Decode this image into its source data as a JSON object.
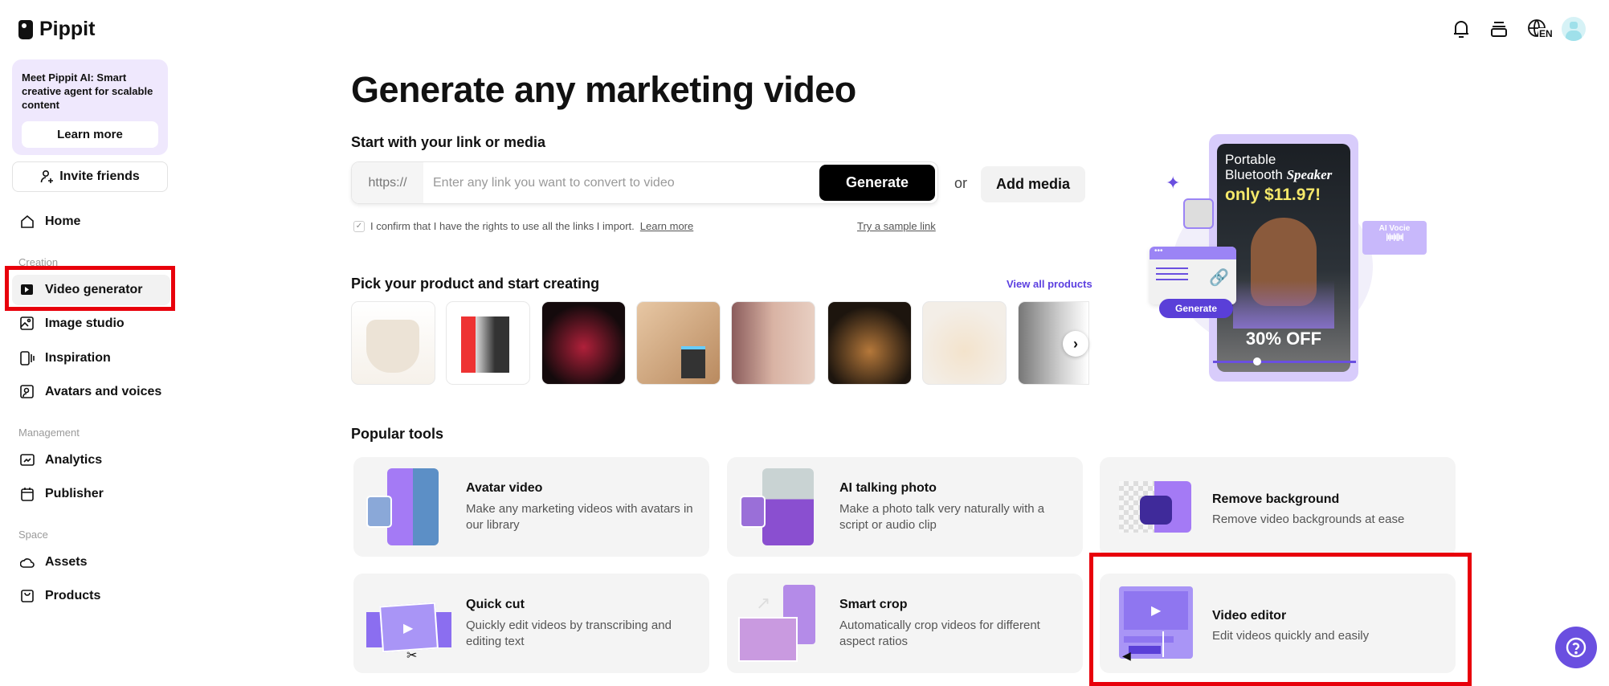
{
  "brand": {
    "name": "Pippit"
  },
  "header": {
    "language": "EN",
    "icons": [
      "bell-icon",
      "credits-icon",
      "globe-icon",
      "avatar"
    ]
  },
  "sidebar": {
    "promo": {
      "text": "Meet Pippit AI: Smart creative agent for scalable content",
      "button": "Learn more"
    },
    "invite": "Invite friends",
    "home": "Home",
    "sections": [
      {
        "label": "Creation",
        "items": [
          "Video generator",
          "Image studio",
          "Inspiration",
          "Avatars and voices"
        ]
      },
      {
        "label": "Management",
        "items": [
          "Analytics",
          "Publisher"
        ]
      },
      {
        "label": "Space",
        "items": [
          "Assets",
          "Products"
        ]
      }
    ],
    "active": "Video generator"
  },
  "main": {
    "title": "Generate any marketing video",
    "link_section": {
      "heading": "Start with your link or media",
      "prefix": "https://",
      "placeholder": "Enter any link you want to convert to video",
      "generate": "Generate",
      "or": "or",
      "add_media": "Add media",
      "confirm_text": "I confirm that I have the rights to use all the links I import.",
      "learn_more": "Learn more",
      "sample": "Try a sample link"
    },
    "products": {
      "heading": "Pick your product and start creating",
      "view_all": "View all products",
      "thumbs": [
        "handbag",
        "product-box",
        "glass-vase",
        "speaker",
        "makeup-palette",
        "candle-lamp",
        "flowers",
        "portrait"
      ]
    },
    "hero": {
      "line1": "Portable",
      "line2": "Bluetooth",
      "line2b": "Speaker",
      "price": "only $11.97!",
      "discount": "30% OFF",
      "ai_voice": "AI Vocie",
      "generate": "Generate"
    },
    "tools": {
      "heading": "Popular tools",
      "items": [
        {
          "title": "Avatar video",
          "desc": "Make any marketing videos with avatars in our library"
        },
        {
          "title": "AI talking photo",
          "desc": "Make a photo talk very naturally with a script or audio clip"
        },
        {
          "title": "Remove background",
          "desc": "Remove video backgrounds at ease"
        },
        {
          "title": "Quick cut",
          "desc": "Quickly edit videos by transcribing and editing text"
        },
        {
          "title": "Smart crop",
          "desc": "Automatically crop videos for different aspect ratios"
        },
        {
          "title": "Video editor",
          "desc": "Edit videos quickly and easily"
        }
      ]
    }
  },
  "colors": {
    "accent": "#6a4fe0",
    "highlight": "#e8000b",
    "promo_bg": "#efe8fd"
  }
}
